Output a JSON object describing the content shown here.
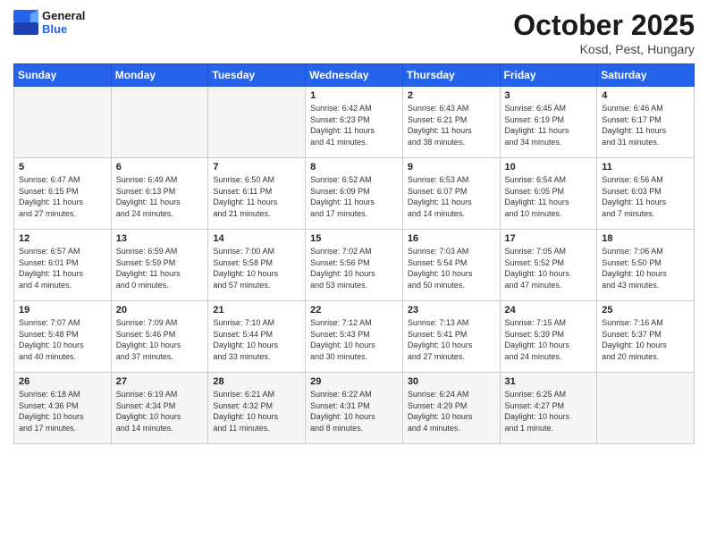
{
  "header": {
    "logo_line1": "General",
    "logo_line2": "Blue",
    "month": "October 2025",
    "location": "Kosd, Pest, Hungary"
  },
  "weekdays": [
    "Sunday",
    "Monday",
    "Tuesday",
    "Wednesday",
    "Thursday",
    "Friday",
    "Saturday"
  ],
  "weeks": [
    [
      {
        "day": "",
        "info": ""
      },
      {
        "day": "",
        "info": ""
      },
      {
        "day": "",
        "info": ""
      },
      {
        "day": "1",
        "info": "Sunrise: 6:42 AM\nSunset: 6:23 PM\nDaylight: 11 hours\nand 41 minutes."
      },
      {
        "day": "2",
        "info": "Sunrise: 6:43 AM\nSunset: 6:21 PM\nDaylight: 11 hours\nand 38 minutes."
      },
      {
        "day": "3",
        "info": "Sunrise: 6:45 AM\nSunset: 6:19 PM\nDaylight: 11 hours\nand 34 minutes."
      },
      {
        "day": "4",
        "info": "Sunrise: 6:46 AM\nSunset: 6:17 PM\nDaylight: 11 hours\nand 31 minutes."
      }
    ],
    [
      {
        "day": "5",
        "info": "Sunrise: 6:47 AM\nSunset: 6:15 PM\nDaylight: 11 hours\nand 27 minutes."
      },
      {
        "day": "6",
        "info": "Sunrise: 6:49 AM\nSunset: 6:13 PM\nDaylight: 11 hours\nand 24 minutes."
      },
      {
        "day": "7",
        "info": "Sunrise: 6:50 AM\nSunset: 6:11 PM\nDaylight: 11 hours\nand 21 minutes."
      },
      {
        "day": "8",
        "info": "Sunrise: 6:52 AM\nSunset: 6:09 PM\nDaylight: 11 hours\nand 17 minutes."
      },
      {
        "day": "9",
        "info": "Sunrise: 6:53 AM\nSunset: 6:07 PM\nDaylight: 11 hours\nand 14 minutes."
      },
      {
        "day": "10",
        "info": "Sunrise: 6:54 AM\nSunset: 6:05 PM\nDaylight: 11 hours\nand 10 minutes."
      },
      {
        "day": "11",
        "info": "Sunrise: 6:56 AM\nSunset: 6:03 PM\nDaylight: 11 hours\nand 7 minutes."
      }
    ],
    [
      {
        "day": "12",
        "info": "Sunrise: 6:57 AM\nSunset: 6:01 PM\nDaylight: 11 hours\nand 4 minutes."
      },
      {
        "day": "13",
        "info": "Sunrise: 6:59 AM\nSunset: 5:59 PM\nDaylight: 11 hours\nand 0 minutes."
      },
      {
        "day": "14",
        "info": "Sunrise: 7:00 AM\nSunset: 5:58 PM\nDaylight: 10 hours\nand 57 minutes."
      },
      {
        "day": "15",
        "info": "Sunrise: 7:02 AM\nSunset: 5:56 PM\nDaylight: 10 hours\nand 53 minutes."
      },
      {
        "day": "16",
        "info": "Sunrise: 7:03 AM\nSunset: 5:54 PM\nDaylight: 10 hours\nand 50 minutes."
      },
      {
        "day": "17",
        "info": "Sunrise: 7:05 AM\nSunset: 5:52 PM\nDaylight: 10 hours\nand 47 minutes."
      },
      {
        "day": "18",
        "info": "Sunrise: 7:06 AM\nSunset: 5:50 PM\nDaylight: 10 hours\nand 43 minutes."
      }
    ],
    [
      {
        "day": "19",
        "info": "Sunrise: 7:07 AM\nSunset: 5:48 PM\nDaylight: 10 hours\nand 40 minutes."
      },
      {
        "day": "20",
        "info": "Sunrise: 7:09 AM\nSunset: 5:46 PM\nDaylight: 10 hours\nand 37 minutes."
      },
      {
        "day": "21",
        "info": "Sunrise: 7:10 AM\nSunset: 5:44 PM\nDaylight: 10 hours\nand 33 minutes."
      },
      {
        "day": "22",
        "info": "Sunrise: 7:12 AM\nSunset: 5:43 PM\nDaylight: 10 hours\nand 30 minutes."
      },
      {
        "day": "23",
        "info": "Sunrise: 7:13 AM\nSunset: 5:41 PM\nDaylight: 10 hours\nand 27 minutes."
      },
      {
        "day": "24",
        "info": "Sunrise: 7:15 AM\nSunset: 5:39 PM\nDaylight: 10 hours\nand 24 minutes."
      },
      {
        "day": "25",
        "info": "Sunrise: 7:16 AM\nSunset: 5:37 PM\nDaylight: 10 hours\nand 20 minutes."
      }
    ],
    [
      {
        "day": "26",
        "info": "Sunrise: 6:18 AM\nSunset: 4:36 PM\nDaylight: 10 hours\nand 17 minutes."
      },
      {
        "day": "27",
        "info": "Sunrise: 6:19 AM\nSunset: 4:34 PM\nDaylight: 10 hours\nand 14 minutes."
      },
      {
        "day": "28",
        "info": "Sunrise: 6:21 AM\nSunset: 4:32 PM\nDaylight: 10 hours\nand 11 minutes."
      },
      {
        "day": "29",
        "info": "Sunrise: 6:22 AM\nSunset: 4:31 PM\nDaylight: 10 hours\nand 8 minutes."
      },
      {
        "day": "30",
        "info": "Sunrise: 6:24 AM\nSunset: 4:29 PM\nDaylight: 10 hours\nand 4 minutes."
      },
      {
        "day": "31",
        "info": "Sunrise: 6:25 AM\nSunset: 4:27 PM\nDaylight: 10 hours\nand 1 minute."
      },
      {
        "day": "",
        "info": ""
      }
    ]
  ]
}
